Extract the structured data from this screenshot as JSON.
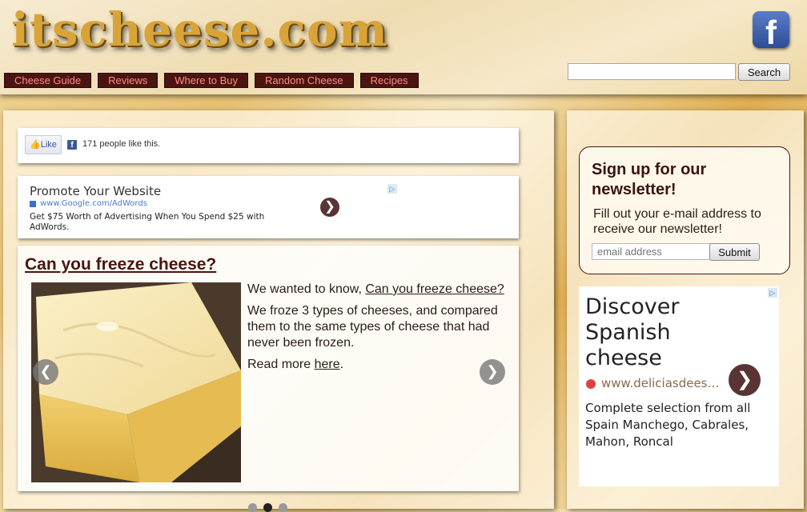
{
  "header": {
    "logo": "itscheese.com",
    "facebook_icon": "facebook-icon",
    "search": {
      "value": "",
      "placeholder": "",
      "button": "Search"
    }
  },
  "nav": {
    "items": [
      {
        "label": "Cheese Guide"
      },
      {
        "label": "Reviews"
      },
      {
        "label": "Where to Buy"
      },
      {
        "label": "Random Cheese"
      },
      {
        "label": "Recipes"
      }
    ]
  },
  "like_box": {
    "button": "Like",
    "count_text": "171 people like this."
  },
  "ad_top": {
    "title": "Promote Your Website",
    "url": "www.Google.com/AdWords",
    "description": "Get $75 Worth of Advertising When You Spend $25 with AdWords.",
    "arrow_icon": "chevron-right-icon"
  },
  "slider": {
    "title": "Can you freeze cheese?",
    "p1_prefix": "We wanted to know, ",
    "p1_link": "Can you freeze cheese?",
    "p2": "We froze 3 types of cheeses, and compared them to the same types of cheese that had never been frozen.",
    "p3_prefix": "Read more ",
    "p3_link": "here",
    "p3_suffix": ".",
    "prev_icon": "chevron-left-icon",
    "next_icon": "chevron-right-icon",
    "active_slide": 2,
    "slide_count": 3
  },
  "newsletter": {
    "title": "Sign up for our newsletter!",
    "description": "Fill out your e-mail address to receive our newsletter!",
    "email_placeholder": "email address",
    "submit": "Submit"
  },
  "side_ad": {
    "title": "Discover Spanish cheese",
    "url": "www.deliciasdees…",
    "description": "Complete selection from all Spain Manchego, Cabrales, Mahon, Roncal"
  },
  "colors": {
    "nav_bg": "#4a1510",
    "nav_text": "#ff8a8a",
    "title_color": "#4a1510",
    "logo_gold": "#d8a43a"
  }
}
